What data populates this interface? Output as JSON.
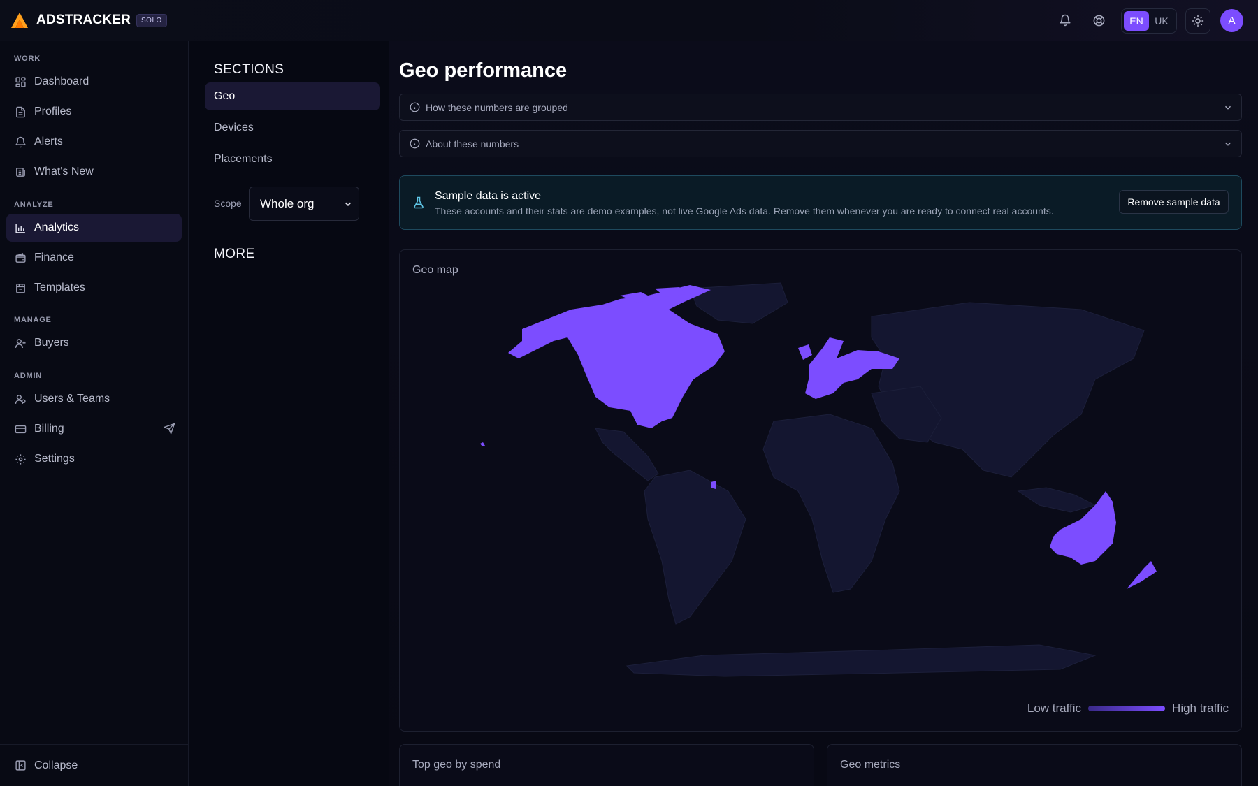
{
  "brand": {
    "name": "ADSTRACKER",
    "badge": "SOLO"
  },
  "topbar": {
    "notifications_icon": "bell-icon",
    "help_icon": "lifebuoy-icon",
    "languages": [
      "EN",
      "UK"
    ],
    "active_language": "EN",
    "theme_icon": "sun-icon",
    "avatar_initial": "A"
  },
  "sidebar": {
    "groups": {
      "work": "WORK",
      "analyze": "ANALYZE",
      "manage": "MANAGE",
      "admin": "ADMIN"
    },
    "items": {
      "dashboard": "Dashboard",
      "profiles": "Profiles",
      "alerts": "Alerts",
      "whats_new": "What's New",
      "analytics": "Analytics",
      "finance": "Finance",
      "templates": "Templates",
      "buyers": "Buyers",
      "users_teams": "Users & Teams",
      "billing": "Billing",
      "settings": "Settings"
    },
    "active": "Analytics",
    "collapse_label": "Collapse"
  },
  "sections": {
    "title": "SECTIONS",
    "items": [
      "Geo",
      "Devices",
      "Placements"
    ],
    "active": "Geo",
    "scope_label": "Scope",
    "scope_value": "Whole org",
    "more_title": "MORE"
  },
  "main": {
    "title": "Geo performance",
    "accordion_grouped": "How these numbers are grouped",
    "accordion_about": "About these numbers",
    "banner": {
      "title": "Sample data is active",
      "text": "These accounts and their stats are demo examples, not live Google Ads data. Remove them whenever you are ready to connect real accounts.",
      "button": "Remove sample data"
    },
    "map": {
      "title": "Geo map",
      "highlighted_regions": [
        "North America",
        "Western Europe",
        "Australia",
        "New Zealand"
      ],
      "legend_low": "Low traffic",
      "legend_high": "High traffic",
      "accent_color": "#7c4dff"
    },
    "top_geo_title": "Top geo by spend",
    "geo_metrics_title": "Geo metrics"
  }
}
